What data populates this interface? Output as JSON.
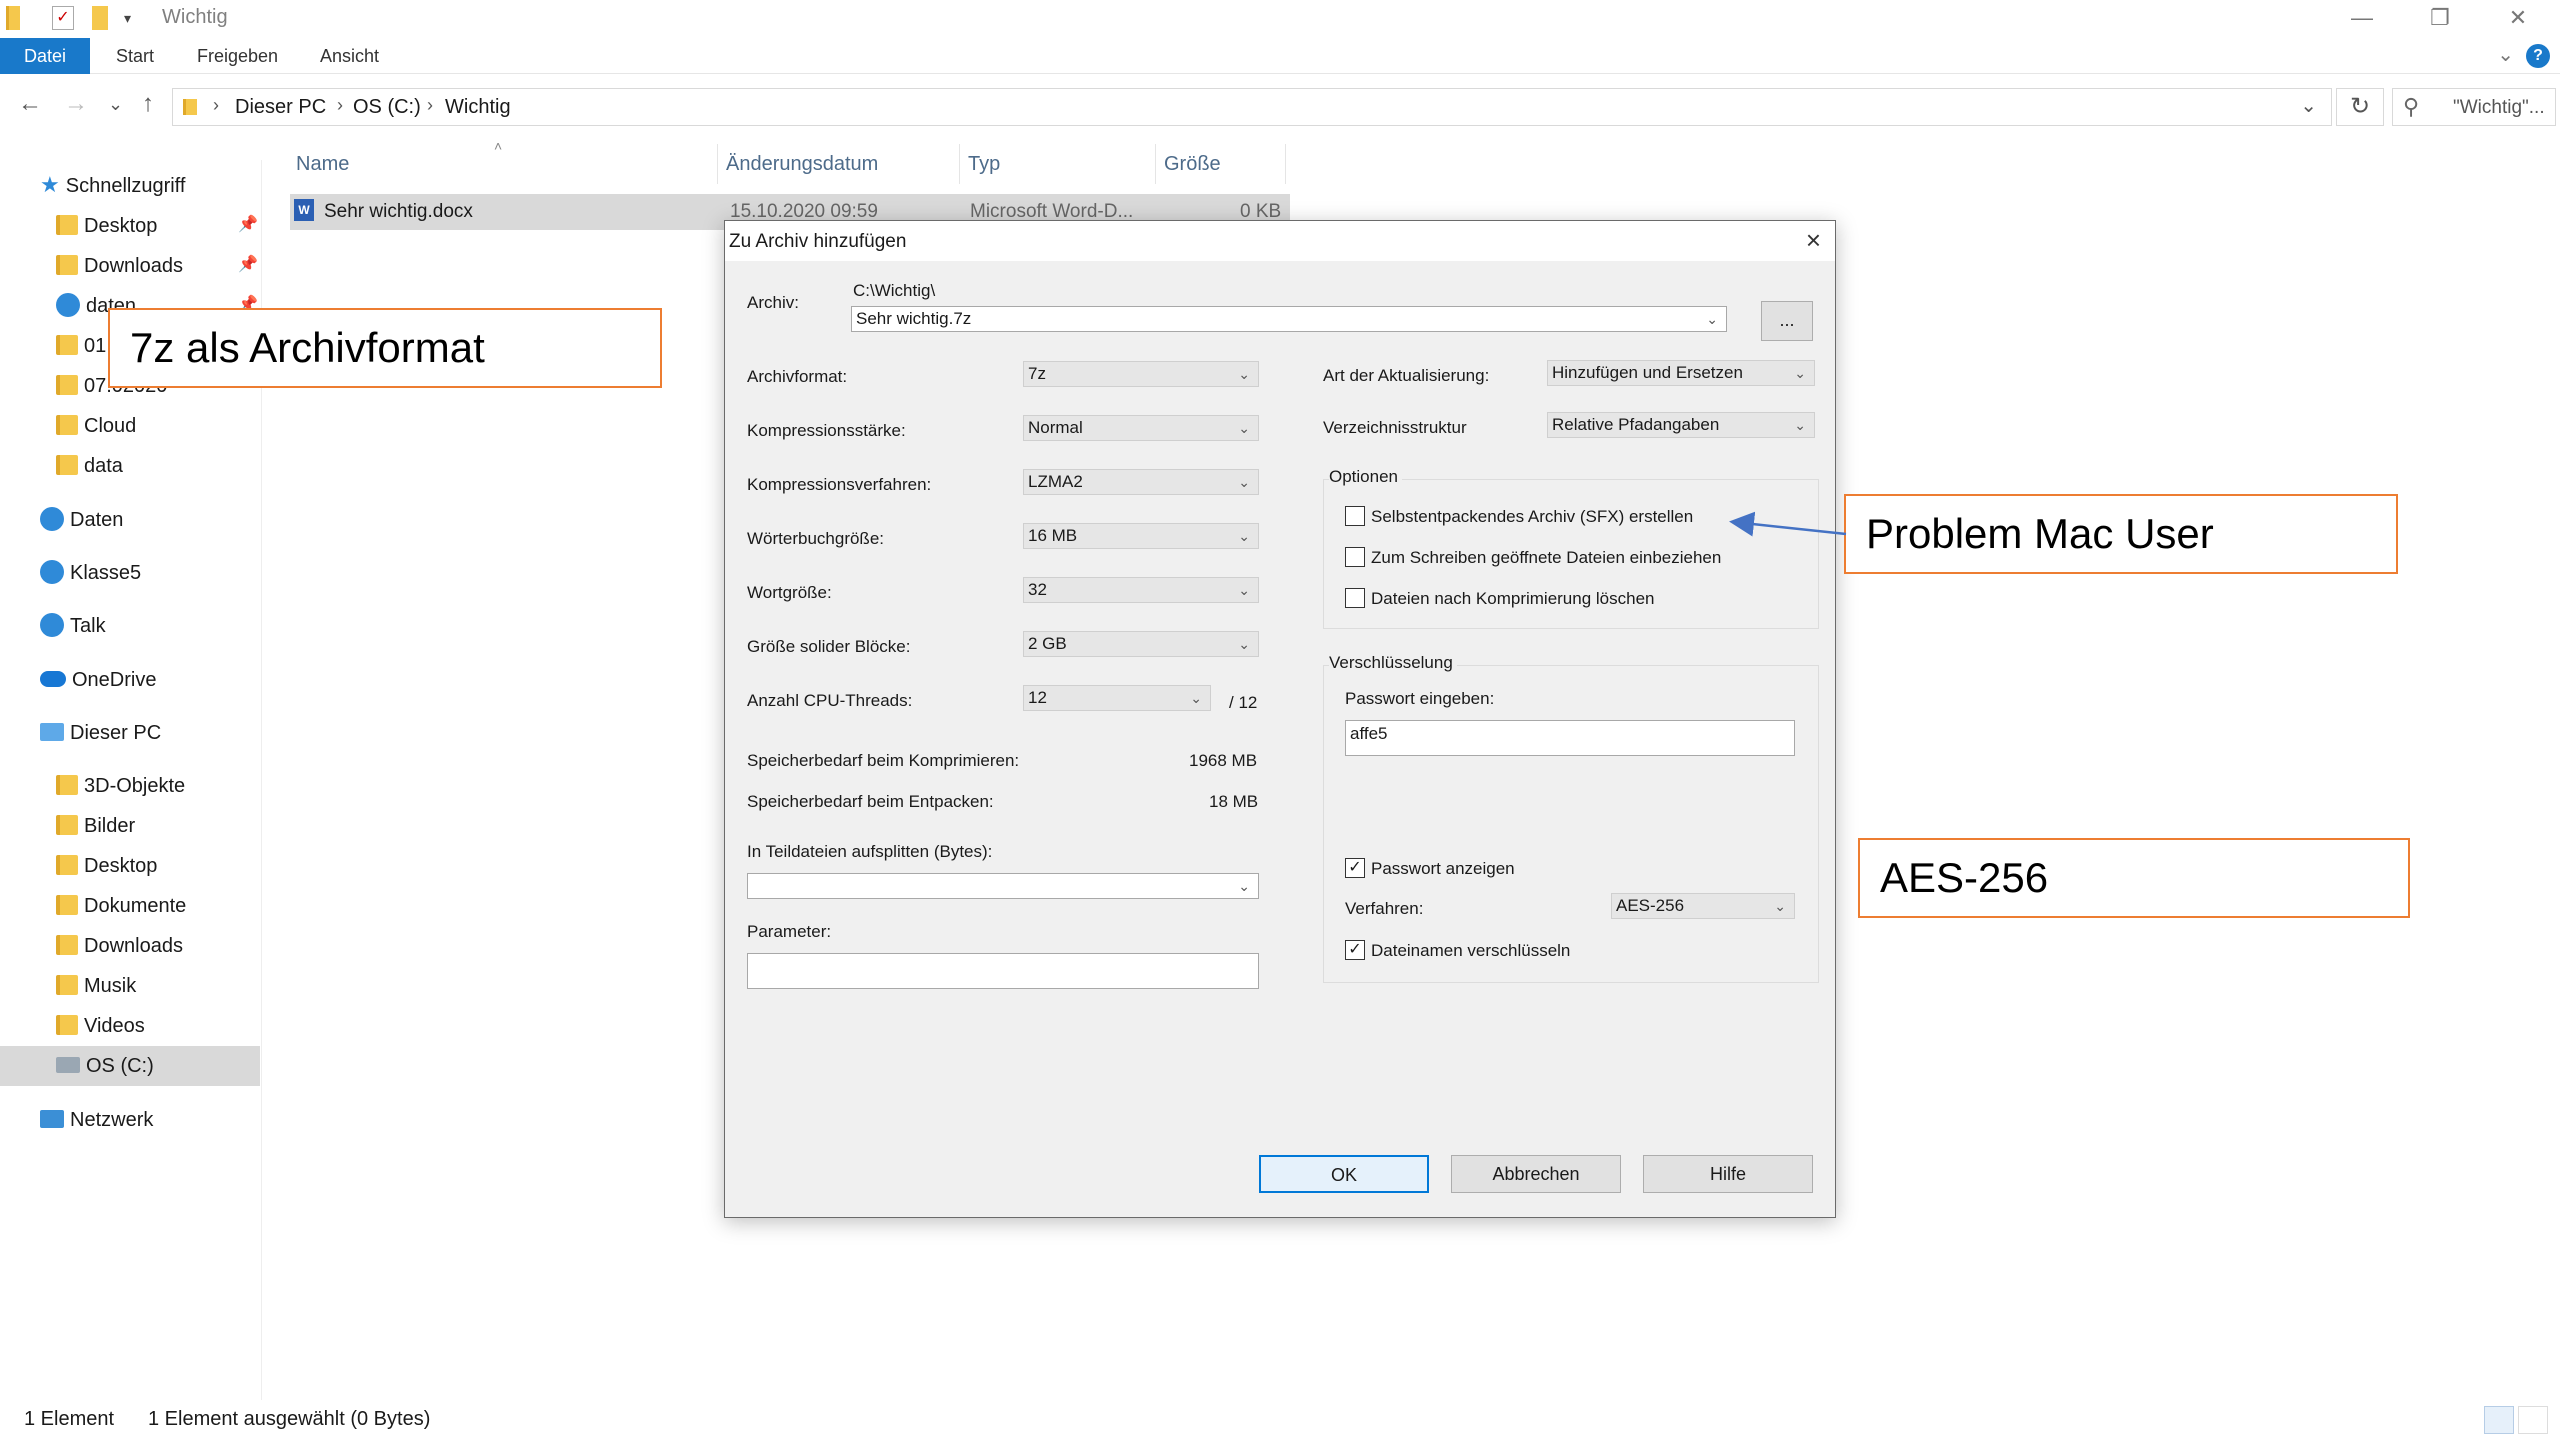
{
  "window": {
    "title": "Wichtig",
    "controls": {
      "minimize": "—",
      "maximize": "❐",
      "close": "✕"
    }
  },
  "ribbon": {
    "tabs": [
      {
        "label": "Datei",
        "active": true
      },
      {
        "label": "Start"
      },
      {
        "label": "Freigeben"
      },
      {
        "label": "Ansicht"
      }
    ],
    "help": "?"
  },
  "address": {
    "crumbs": [
      "Dieser PC",
      "OS (C:)",
      "Wichtig"
    ],
    "search_placeholder": "\"Wichtig\"..."
  },
  "sidebar": {
    "items": [
      {
        "label": "Schnellzugriff",
        "icon": "star-icon",
        "pinned": false
      },
      {
        "label": "Desktop",
        "icon": "folder-icon",
        "pinned": true
      },
      {
        "label": "Downloads",
        "icon": "folder-icon",
        "pinned": true
      },
      {
        "label": "daten",
        "icon": "people-icon",
        "pinned": true
      },
      {
        "label": "01",
        "icon": "folder-icon",
        "pinned": false
      },
      {
        "label": "07.02020",
        "icon": "folder-icon",
        "pinned": false
      },
      {
        "label": "Cloud",
        "icon": "folder-icon",
        "pinned": false
      },
      {
        "label": "data",
        "icon": "folder-icon",
        "pinned": false
      },
      {
        "label": "Daten",
        "icon": "people-icon",
        "pinned": false
      },
      {
        "label": "Klasse5",
        "icon": "people-icon",
        "pinned": false
      },
      {
        "label": "Talk",
        "icon": "people-icon",
        "pinned": false
      },
      {
        "label": "OneDrive",
        "icon": "cloud-icon",
        "pinned": false
      },
      {
        "label": "Dieser PC",
        "icon": "pc-icon",
        "pinned": false
      },
      {
        "label": "3D-Objekte",
        "icon": "folder-icon",
        "pinned": false
      },
      {
        "label": "Bilder",
        "icon": "folder-icon",
        "pinned": false
      },
      {
        "label": "Desktop",
        "icon": "folder-icon",
        "pinned": false
      },
      {
        "label": "Dokumente",
        "icon": "folder-icon",
        "pinned": false
      },
      {
        "label": "Downloads",
        "icon": "folder-icon",
        "pinned": false
      },
      {
        "label": "Musik",
        "icon": "folder-icon",
        "pinned": false
      },
      {
        "label": "Videos",
        "icon": "folder-icon",
        "pinned": false
      },
      {
        "label": "OS (C:)",
        "icon": "drive-icon",
        "pinned": false,
        "selected": true
      },
      {
        "label": "Netzwerk",
        "icon": "network-icon",
        "pinned": false
      }
    ]
  },
  "filelist": {
    "columns": [
      "Name",
      "Änderungsdatum",
      "Typ",
      "Größe"
    ],
    "rows": [
      {
        "name": "Sehr wichtig.docx",
        "date": "15.10.2020 09:59",
        "type": "Microsoft Word-D...",
        "size": "0 KB"
      }
    ]
  },
  "statusbar": {
    "count": "1 Element",
    "selection": "1 Element ausgewählt (0 Bytes)"
  },
  "dialog": {
    "title": "Zu Archiv hinzufügen",
    "archive_label": "Archiv:",
    "archive_path": "C:\\Wichtig\\",
    "archive_name": "Sehr wichtig.7z",
    "browse": "...",
    "fields": [
      {
        "label": "Archivformat:",
        "value": "7z"
      },
      {
        "label": "Kompressionsstärke:",
        "value": "Normal"
      },
      {
        "label": "Kompressionsverfahren:",
        "value": "LZMA2"
      },
      {
        "label": "Wörterbuchgröße:",
        "value": "16 MB"
      },
      {
        "label": "Wortgröße:",
        "value": "32"
      },
      {
        "label": "Größe solider Blöcke:",
        "value": "2 GB"
      },
      {
        "label": "Anzahl CPU-Threads:",
        "value": "12"
      }
    ],
    "threads_max": "/ 12",
    "mem_compress_label": "Speicherbedarf beim Komprimieren:",
    "mem_compress_value": "1968 MB",
    "mem_extract_label": "Speicherbedarf beim Entpacken:",
    "mem_extract_value": "18 MB",
    "split_label": "In Teildateien aufsplitten (Bytes):",
    "split_value": "",
    "param_label": "Parameter:",
    "param_value": "",
    "update_label": "Art der Aktualisierung:",
    "update_value": "Hinzufügen und Ersetzen",
    "dirs_label": "Verzeichnisstruktur",
    "dirs_value": "Relative Pfadangaben",
    "options_title": "Optionen",
    "options": [
      {
        "label": "Selbstentpackendes Archiv (SFX) erstellen",
        "checked": false
      },
      {
        "label": "Zum Schreiben geöffnete Dateien einbeziehen",
        "checked": false
      },
      {
        "label": "Dateien nach Komprimierung löschen",
        "checked": false
      }
    ],
    "enc_title": "Verschlüsselung",
    "pw_label": "Passwort eingeben:",
    "pw_value": "affe5",
    "show_pw_label": "Passwort anzeigen",
    "show_pw_checked": true,
    "method_label": "Verfahren:",
    "method_value": "AES-256",
    "encrypt_names_label": "Dateinamen verschlüsseln",
    "encrypt_names_checked": true,
    "buttons": {
      "ok": "OK",
      "cancel": "Abbrechen",
      "help": "Hilfe"
    }
  },
  "annotations": {
    "format": "7z als Archivformat",
    "mac": "Problem Mac User",
    "aes": "AES-256",
    "color": "#ed7d31",
    "arrow_color": "#4472c4"
  }
}
